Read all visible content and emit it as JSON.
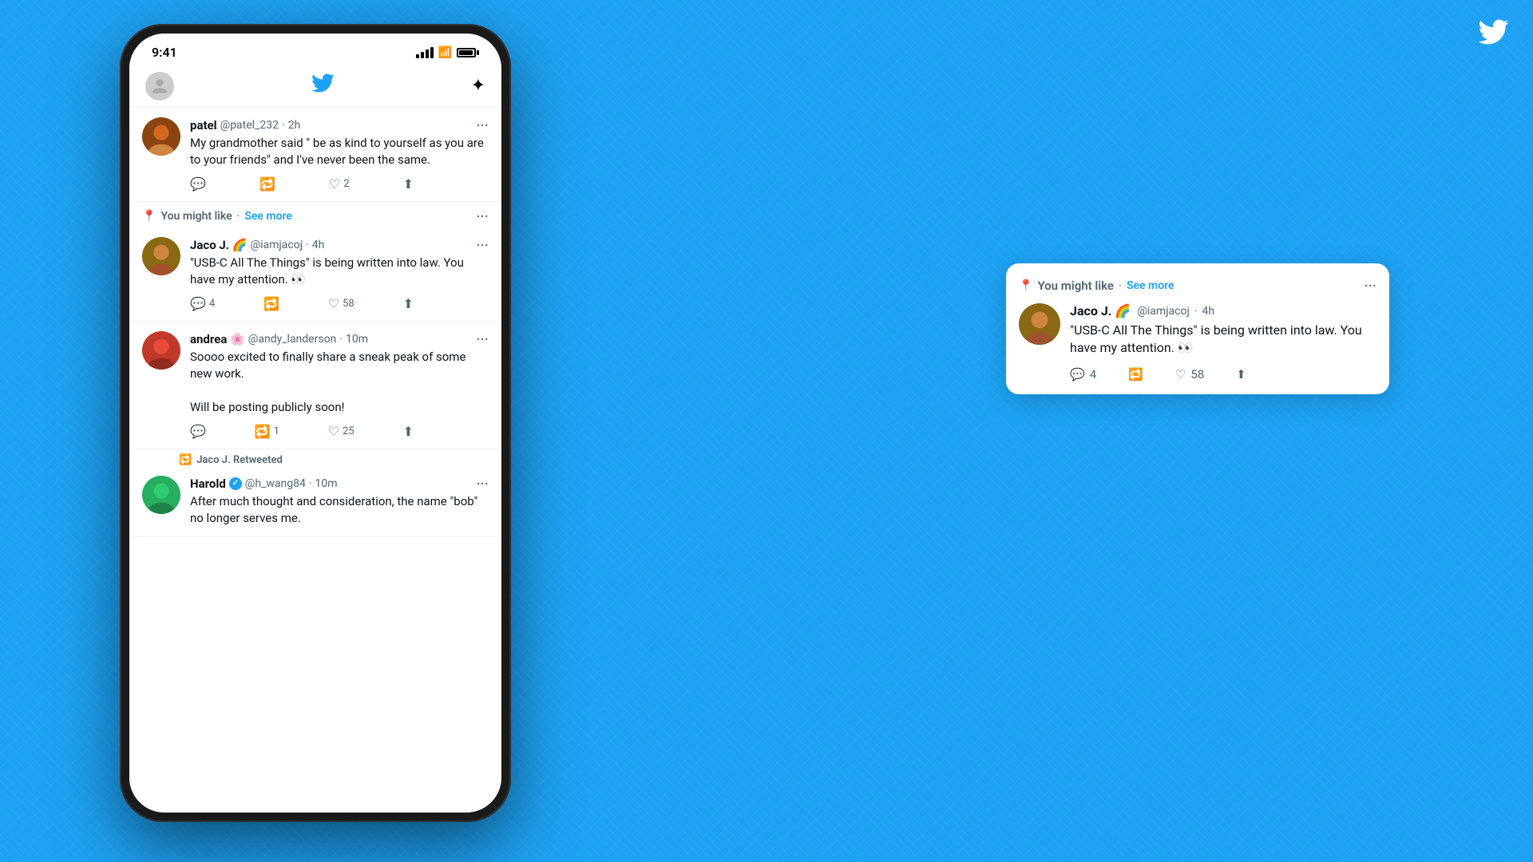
{
  "background": {
    "color": "#1da1f2"
  },
  "twitter_logo": "🐦",
  "phone": {
    "status_bar": {
      "time": "9:41"
    },
    "header": {
      "sparkle": "✦"
    },
    "tweets": [
      {
        "id": "patel",
        "name": "patel",
        "handle": "@patel_232",
        "time": "2h",
        "text": "My grandmother said \" be as kind to yourself as you are to your friends\" and I've never been the same.",
        "actions": {
          "reply": "",
          "retweet": "",
          "like": "2",
          "share": ""
        }
      },
      {
        "id": "jaco_recommended",
        "section": "You might like",
        "see_more": "See more",
        "name": "Jaco J. 🌈",
        "handle": "@iamjacoj",
        "time": "4h",
        "text": "\"USB-C All The Things\" is being written into law. You have my attention. 👀",
        "actions": {
          "reply": "4",
          "retweet": "",
          "like": "58",
          "share": ""
        }
      },
      {
        "id": "andrea",
        "name": "andrea 🌸",
        "handle": "@andy_landerson",
        "time": "10m",
        "text": "Soooo excited to finally share a sneak peak of some new work.\n\nWill be posting publicly soon!",
        "actions": {
          "reply": "",
          "retweet": "1",
          "like": "25",
          "share": ""
        }
      },
      {
        "id": "harold",
        "retweeted_by": "Jaco J. Retweeted",
        "name": "Harold",
        "verified": true,
        "handle": "@h_wang84",
        "time": "10m",
        "text": "After much thought and consideration, the name  \"bob\" no longer serves me.",
        "actions": {
          "reply": "",
          "retweet": "",
          "like": "",
          "share": ""
        }
      }
    ]
  },
  "popup": {
    "section": "You might like",
    "see_more": "See more",
    "name": "Jaco J. 🌈",
    "handle": "@iamjacoj",
    "time": "4h",
    "text": "\"USB-C All The Things\" is being written into law. You have my attention. 👀",
    "actions": {
      "reply": "4",
      "retweet": "",
      "like": "58",
      "share": ""
    }
  }
}
